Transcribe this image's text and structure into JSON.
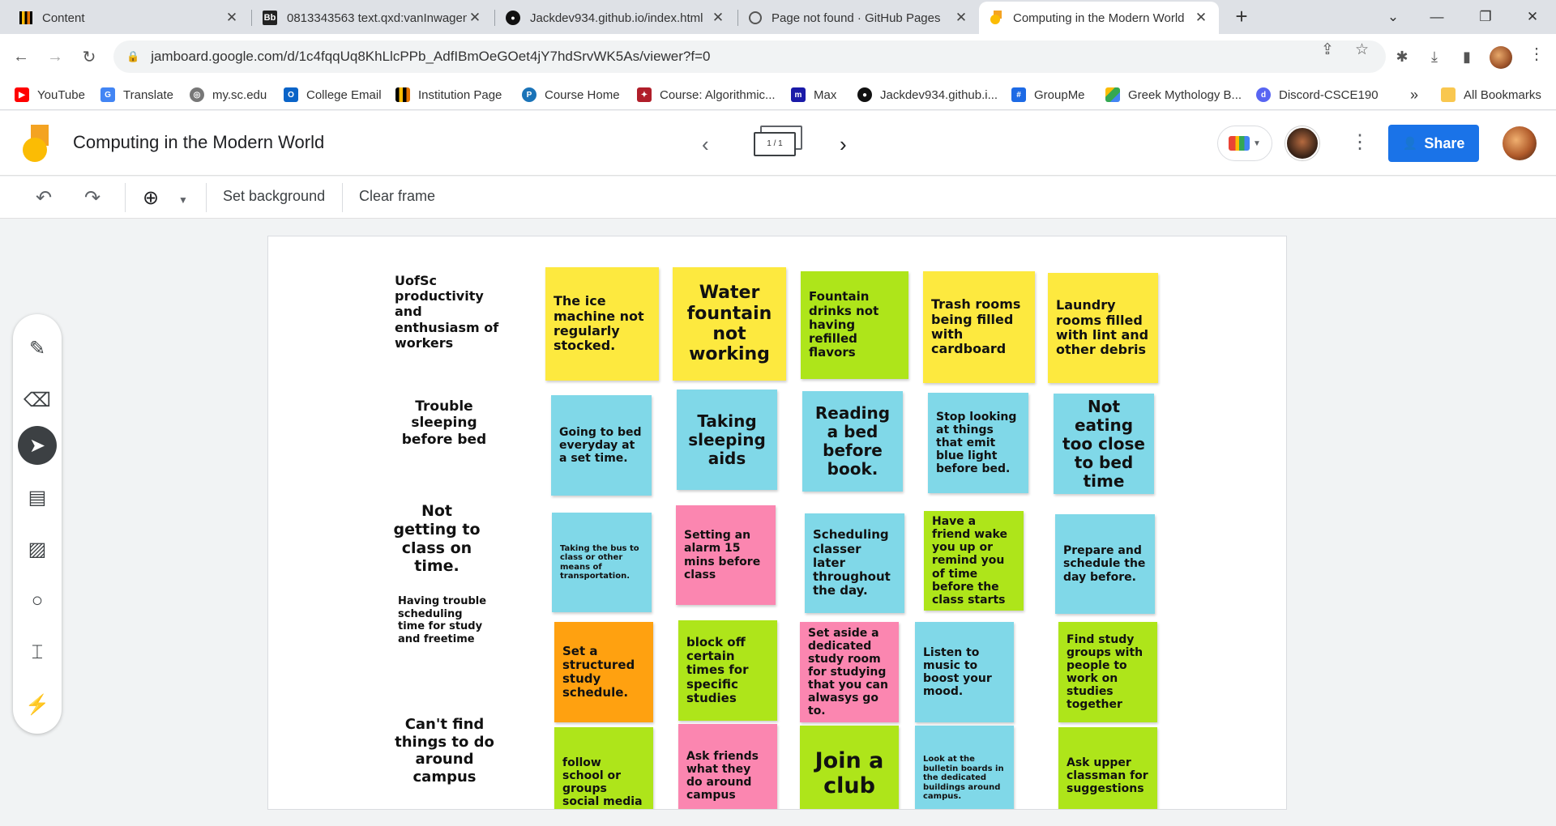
{
  "browser": {
    "tabs": [
      {
        "title": "Content",
        "icon": "bar-chart-icon"
      },
      {
        "title": "0813343563 text.qxd:vanInwagen",
        "icon": "blackboard-icon"
      },
      {
        "title": "Jackdev934.github.io/index.html",
        "icon": "github-icon"
      },
      {
        "title": "Page not found · GitHub Pages",
        "icon": "globe-icon"
      },
      {
        "title": "Computing in the Modern World",
        "icon": "jamboard-icon"
      }
    ],
    "url": "jamboard.google.com/d/1c4fqqUq8KhLlcPPb_AdfIBmOeGOet4jY7hdSrvWK5As/viewer?f=0",
    "bookmarks": [
      "YouTube",
      "Translate",
      "my.sc.edu",
      "College Email",
      "Institution Page",
      "Course Home",
      "Course: Algorithmic...",
      "Max",
      "Jackdev934.github.i...",
      "GroupMe",
      "Greek Mythology B...",
      "Discord-CSCE190"
    ],
    "more_bookmarks": "»",
    "all_bookmarks": "All Bookmarks"
  },
  "jamboard": {
    "title": "Computing in the Modern World",
    "frame_indicator": "1 / 1",
    "share_label": "Share",
    "toolbar": {
      "set_background": "Set background",
      "clear_frame": "Clear frame"
    }
  },
  "board": {
    "row_labels": [
      "UofSc productivity and enthusiasm of workers",
      "Trouble sleeping before bed",
      "Not getting to class on time.",
      "Having trouble scheduling time for study and freetime",
      "Can't find things to do around campus"
    ],
    "notes": [
      "The ice machine not regularly stocked.",
      "Water fountain not working",
      "Fountain drinks not having refilled flavors",
      "Trash rooms being filled with cardboard",
      "Laundry rooms filled with lint and other debris",
      "Going to bed everyday at a set time.",
      "Taking sleeping aids",
      "Reading a bed before book.",
      "Stop looking at things that emit blue light before bed.",
      "Not eating too close to bed time",
      "Taking the bus to class or other means of transportation.",
      "Setting an alarm 15 mins before class",
      "Scheduling classer later throughout the day.",
      "Have a friend wake you up or remind you of time before the class starts",
      "Prepare and schedule the day before.",
      "Set a structured study schedule.",
      "block off certain times for specific studies",
      "Set aside a dedicated study room for studying that you can alwasys go to.",
      "Listen to music to boost your mood.",
      "Find study groups with people to work on studies together",
      "follow school or groups social media",
      "Ask friends what they do around campus",
      "Join a club",
      "Look at the bulletin boards in the dedicated buildings around campus.",
      "Ask upper classman for suggestions"
    ],
    "colors": {
      "yellow": "#fde93f",
      "green": "#aee51a",
      "blue": "#80d8e8",
      "pink": "#fb86b0",
      "orange": "#ffa110"
    }
  }
}
